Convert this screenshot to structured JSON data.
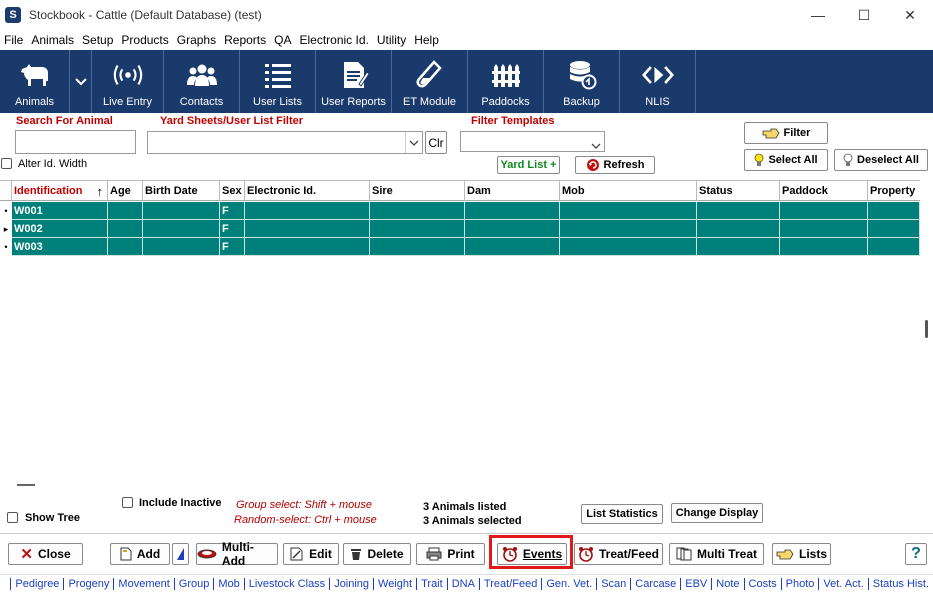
{
  "window": {
    "title": "Stockbook - Cattle (Default Database) (test)",
    "app_icon": "S",
    "minimize": "—",
    "maximize": "☐",
    "close": "✕"
  },
  "menu": [
    "File",
    "Animals",
    "Setup",
    "Products",
    "Graphs",
    "Reports",
    "QA",
    "Electronic Id.",
    "Utility",
    "Help"
  ],
  "toolbar": {
    "items": [
      {
        "label": "Animals",
        "icon": "cow-icon"
      },
      {
        "label": "Live Entry",
        "icon": "broadcast-icon"
      },
      {
        "label": "Contacts",
        "icon": "people-icon"
      },
      {
        "label": "User Lists",
        "icon": "list-icon"
      },
      {
        "label": "User Reports",
        "icon": "report-icon"
      },
      {
        "label": "ET Module",
        "icon": "test-tube-icon"
      },
      {
        "label": "Paddocks",
        "icon": "fence-icon"
      },
      {
        "label": "Backup",
        "icon": "database-icon"
      },
      {
        "label": "NLIS",
        "icon": "nlis-icon"
      }
    ]
  },
  "filters": {
    "search_label": "Search For Animal",
    "search_value": "",
    "yard_label": "Yard Sheets/User List Filter",
    "yard_value": "",
    "clr_label": "Clr",
    "templates_label": "Filter Templates",
    "templates_value": "",
    "alter_id_width": "Alter Id. Width",
    "yard_list_plus": "Yard List +",
    "refresh": "Refresh",
    "filter": "Filter",
    "select_all": "Select All",
    "deselect_all": "Deselect All"
  },
  "grid": {
    "columns": [
      "Identification",
      "Age",
      "Birth Date",
      "Sex",
      "Electronic Id.",
      "Sire",
      "Dam",
      "Mob",
      "Status",
      "Paddock",
      "Property"
    ],
    "sort_indicator": "↑",
    "rows": [
      {
        "marker": "•",
        "cells": [
          "W001",
          "",
          "",
          "F",
          "",
          "",
          "",
          "",
          "",
          "",
          ""
        ]
      },
      {
        "marker": "▸",
        "cells": [
          "W002",
          "",
          "",
          "F",
          "",
          "",
          "",
          "",
          "",
          "",
          ""
        ]
      },
      {
        "marker": "•",
        "cells": [
          "W003",
          "",
          "",
          "F",
          "",
          "",
          "",
          "",
          "",
          "",
          ""
        ]
      }
    ]
  },
  "footer": {
    "show_tree": "Show Tree",
    "include_inactive": "Include Inactive",
    "group_hint": "Group select: Shift + mouse",
    "random_hint": "Random-select: Ctrl + mouse",
    "animals_listed": "3 Animals listed",
    "animals_selected": "3 Animals selected",
    "list_statistics": "List Statistics",
    "change_display": "Change Display"
  },
  "actions": {
    "close": "Close",
    "add": "Add",
    "multi_add": "Multi-Add",
    "edit": "Edit",
    "delete": "Delete",
    "print": "Print",
    "events": "Events",
    "treat_feed": "Treat/Feed",
    "multi_treat": "Multi Treat",
    "lists": "Lists",
    "help": "?"
  },
  "links": [
    "Pedigree",
    "Progeny",
    "Movement",
    "Group",
    "Mob",
    "Livestock Class",
    "Joining",
    "Weight",
    "Trait",
    "DNA",
    "Treat/Feed",
    "Gen. Vet.",
    "Scan",
    "Carcase",
    "EBV",
    "Note",
    "Costs",
    "Photo",
    "Vet. Act.",
    "Status Hist."
  ],
  "colors": {
    "toolbar_bg": "#1a3a6b",
    "row_bg": "#00807a",
    "label_red": "#c00000",
    "highlight": "#e0191b",
    "link_blue": "#1a3fbf"
  }
}
